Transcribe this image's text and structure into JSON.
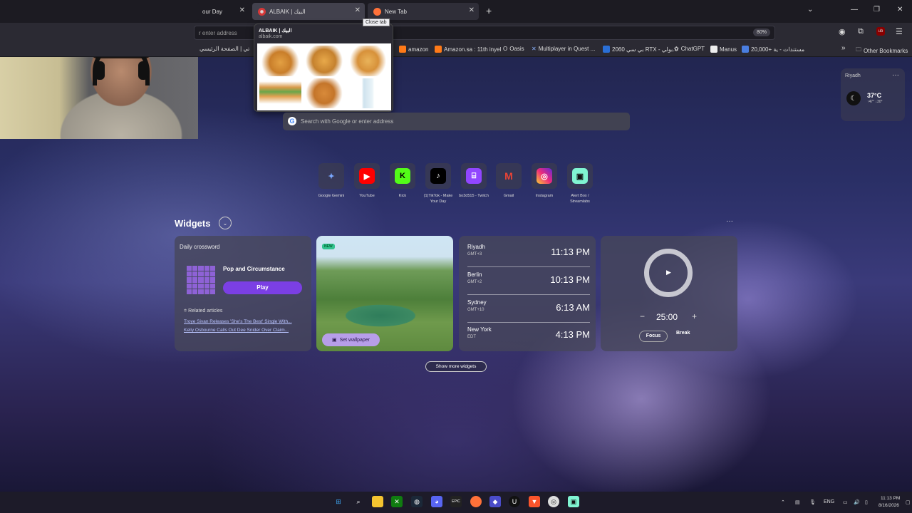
{
  "tabs": [
    {
      "label": "our Day"
    },
    {
      "label": "ALBAIK | البيك"
    },
    {
      "label": "New Tab"
    }
  ],
  "tooltip": "Close tab",
  "preview": {
    "title": "ALBAIK | البيك",
    "url": "albaik.com"
  },
  "urlbar": {
    "placeholder": "r enter address",
    "zoom": "80%"
  },
  "bookmarks": [
    {
      "label": "تي | الصفحة الرئيسي"
    },
    {
      "label": "amazon"
    },
    {
      "label": "Amazon.sa : 11th inyel"
    },
    {
      "label": "Oasis"
    },
    {
      "label": "Multiplayer in Quest ..."
    },
    {
      "label": "2060 بي سي RTX - بولي..."
    },
    {
      "label": "ChatGPT"
    },
    {
      "label": "Manus"
    },
    {
      "label": "20,000+ مستندات - ية"
    },
    {
      "label": "Other Bookmarks"
    }
  ],
  "search": {
    "placeholder": "Search with Google or enter address"
  },
  "weather": {
    "location": "Riyadh",
    "temp": "37°C",
    "hilo": "↑47° ↓30°"
  },
  "shortcuts": [
    {
      "label": "Google Gemini",
      "icon": "gemini-icon",
      "color": "#2a2a38"
    },
    {
      "label": "YouTube",
      "icon": "youtube-icon",
      "color": "#ff0000"
    },
    {
      "label": "Kick",
      "icon": "kick-icon",
      "color": "#53fc18"
    },
    {
      "label": "(1)TikTok - Make Your Day",
      "icon": "tiktok-icon",
      "color": "#000000"
    },
    {
      "label": "bo3d515 - Twitch",
      "icon": "twitch-icon",
      "color": "#9146ff"
    },
    {
      "label": "Gmail",
      "icon": "gmail-icon",
      "color": "#2a2a38"
    },
    {
      "label": "Instagram",
      "icon": "instagram-icon",
      "color": "#d6249f"
    },
    {
      "label": "Alert Box / Streamlabs",
      "icon": "streamlabs-icon",
      "color": "#80f5d2"
    }
  ],
  "widgets": {
    "title": "Widgets",
    "crossword": {
      "title": "Daily crossword",
      "puzzle": "Pop and Circumstance",
      "play": "Play",
      "related": "Related articles",
      "links": [
        "Troye Sivan Releases 'She's The Best' Single With...",
        "Kelly Osbourne Calls Out Dee Snider Over Claim..."
      ]
    },
    "wallpaper": {
      "badge": "NEW",
      "button": "Set wallpaper"
    },
    "clocks": [
      {
        "city": "Riyadh",
        "tz": "GMT+3",
        "time": "11:13 PM"
      },
      {
        "city": "Berlin",
        "tz": "GMT+2",
        "time": "10:13 PM"
      },
      {
        "city": "Sydney",
        "tz": "GMT+10",
        "time": "6:13 AM"
      },
      {
        "city": "New York",
        "tz": "EDT",
        "time": "4:13 PM"
      }
    ],
    "focus": {
      "time": "25:00",
      "focus": "Focus",
      "break": "Break"
    },
    "show_more": "Show more widgets"
  },
  "tray": {
    "lang": "ENG",
    "time": "11:13 PM",
    "date": "8/16/2026"
  }
}
